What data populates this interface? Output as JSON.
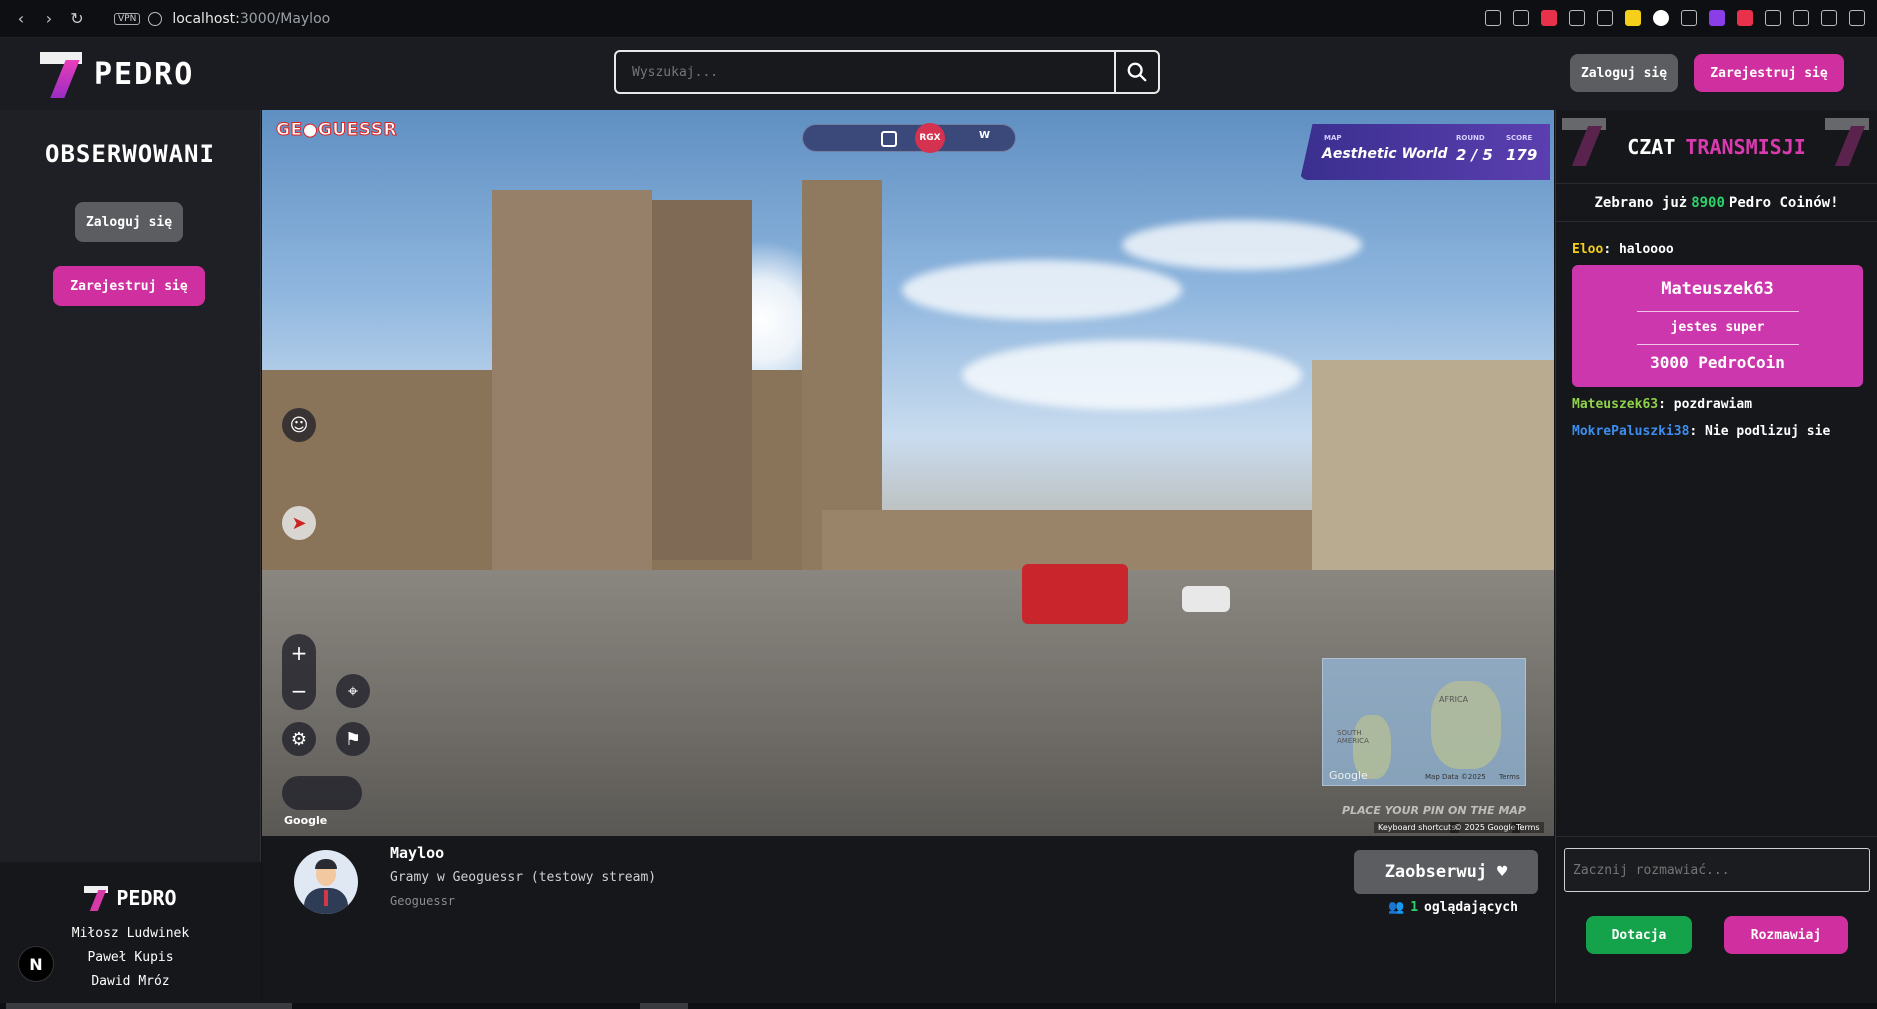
{
  "browser": {
    "url_host": "localhost:",
    "url_port_path": "3000/Mayloo",
    "vpn_label": "VPN"
  },
  "header": {
    "logo_text": "PEDRO",
    "search_placeholder": "Wyszukaj...",
    "login_label": "Zaloguj się",
    "register_label": "Zarejestruj się"
  },
  "sidebar": {
    "title": "OBSERWOWANI",
    "login_label": "Zaloguj się",
    "register_label": "Zarejestruj się",
    "footer_logo": "PEDRO",
    "authors": [
      "Miłosz Ludwinek",
      "Paweł Kupis",
      "Dawid Mróz"
    ],
    "badge": "N"
  },
  "game": {
    "logo": "GE●GUESSR",
    "rgx": "RGX",
    "w_label": "W",
    "map_label": "MAP",
    "map_value": "Aesthetic World",
    "round_label": "ROUND",
    "round_value": "2 / 5",
    "score_label": "SCORE",
    "score_value": "179",
    "google_mark": "Google",
    "minimap_google": "Google",
    "minimap_africa": "AFRICA",
    "minimap_south_america": "SOUTH AMERICA",
    "minimap_data": "Map Data ©2025",
    "minimap_terms": "Terms",
    "place_pin": "PLACE YOUR PIN ON THE MAP",
    "footer_shortcuts": "Keyboard shortcuts",
    "footer_copy": "© 2025 Google",
    "footer_terms": "Terms"
  },
  "stream_info": {
    "streamer": "Mayloo",
    "title": "Gramy w Geoguessr (testowy stream)",
    "category": "Geoguessr",
    "follow_label": "Zaobserwuj",
    "viewers_count": "1",
    "viewers_label": "oglądających"
  },
  "chat": {
    "title_white": "CZAT",
    "title_pink": "TRANSMISJI",
    "coins_prefix": "Zebrano już",
    "coins_amount": "8900",
    "coins_suffix": "Pedro Coinów!",
    "messages": [
      {
        "user": "Eloo",
        "text": " halоооо",
        "color": "#f4d01b"
      },
      {
        "user": "Mateuszek63",
        "text": " pozdrawiam",
        "color": "#8fd14a"
      },
      {
        "user": "MokrePaluszki38",
        "text": " Nie podlizuj sie",
        "color": "#3d8ef0"
      }
    ],
    "donation": {
      "user": "Mateuszek63",
      "message": "jestes super",
      "amount": "3000 PedroCoin"
    },
    "input_placeholder": "Zacznij rozmawiać...",
    "donate_label": "Dotacja",
    "chat_label": "Rozmawiaj"
  },
  "colors": {
    "accent_pink": "#d02f9f",
    "green": "#14a24a"
  }
}
